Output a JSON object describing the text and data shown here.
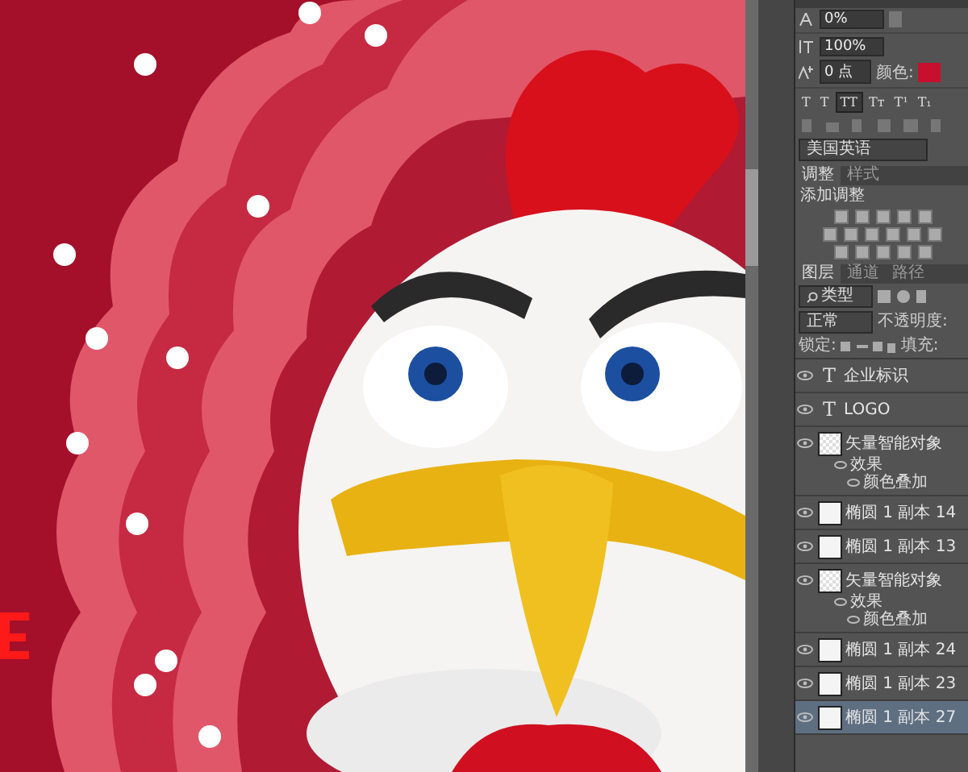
{
  "character_panel": {
    "tracking": "0%",
    "vertical_scale": "100%",
    "baseline_shift": "0 点",
    "color_label": "颜色:",
    "style_buttons": [
      {
        "label": "T",
        "selected": false
      },
      {
        "label": "T",
        "selected": false
      },
      {
        "label": "TT",
        "selected": true
      },
      {
        "label": "Tт",
        "selected": false
      },
      {
        "label": "T¹",
        "selected": false
      },
      {
        "label": "T₁",
        "selected": false
      }
    ],
    "language": "美国英语"
  },
  "adjustments": {
    "tabs": [
      {
        "label": "调整",
        "selected": true
      },
      {
        "label": "样式",
        "selected": false
      }
    ],
    "title": "添加调整"
  },
  "layers": {
    "tabs": [
      {
        "label": "图层",
        "selected": true
      },
      {
        "label": "通道",
        "selected": false
      },
      {
        "label": "路径",
        "selected": false
      }
    ],
    "filter": "类型",
    "blend_mode": "正常",
    "opacity_label": "不透明度:",
    "lock_label": "锁定:",
    "fill_label": "填充:",
    "items": [
      {
        "kind": "text",
        "glyph": "T",
        "name": "企业标识",
        "selected": false
      },
      {
        "kind": "text",
        "glyph": "T",
        "name": "LOGO",
        "selected": false
      },
      {
        "kind": "smart",
        "name": "矢量智能对象",
        "selected": false,
        "children": [
          {
            "name": "效果",
            "children": [
              {
                "name": "颜色叠加"
              }
            ]
          }
        ]
      },
      {
        "kind": "shape",
        "name": "椭圆 1 副本 14",
        "selected": false
      },
      {
        "kind": "shape",
        "name": "椭圆 1 副本 13",
        "selected": false
      },
      {
        "kind": "smart",
        "name": "矢量智能对象",
        "selected": false,
        "children": [
          {
            "name": "效果",
            "children": [
              {
                "name": "颜色叠加"
              }
            ]
          }
        ]
      },
      {
        "kind": "shape",
        "name": "椭圆 1 副本 24",
        "selected": false
      },
      {
        "kind": "shape",
        "name": "椭圆 1 副本 23",
        "selected": false
      },
      {
        "kind": "shape",
        "name": "椭圆 1 副本 27",
        "selected": true
      }
    ]
  }
}
